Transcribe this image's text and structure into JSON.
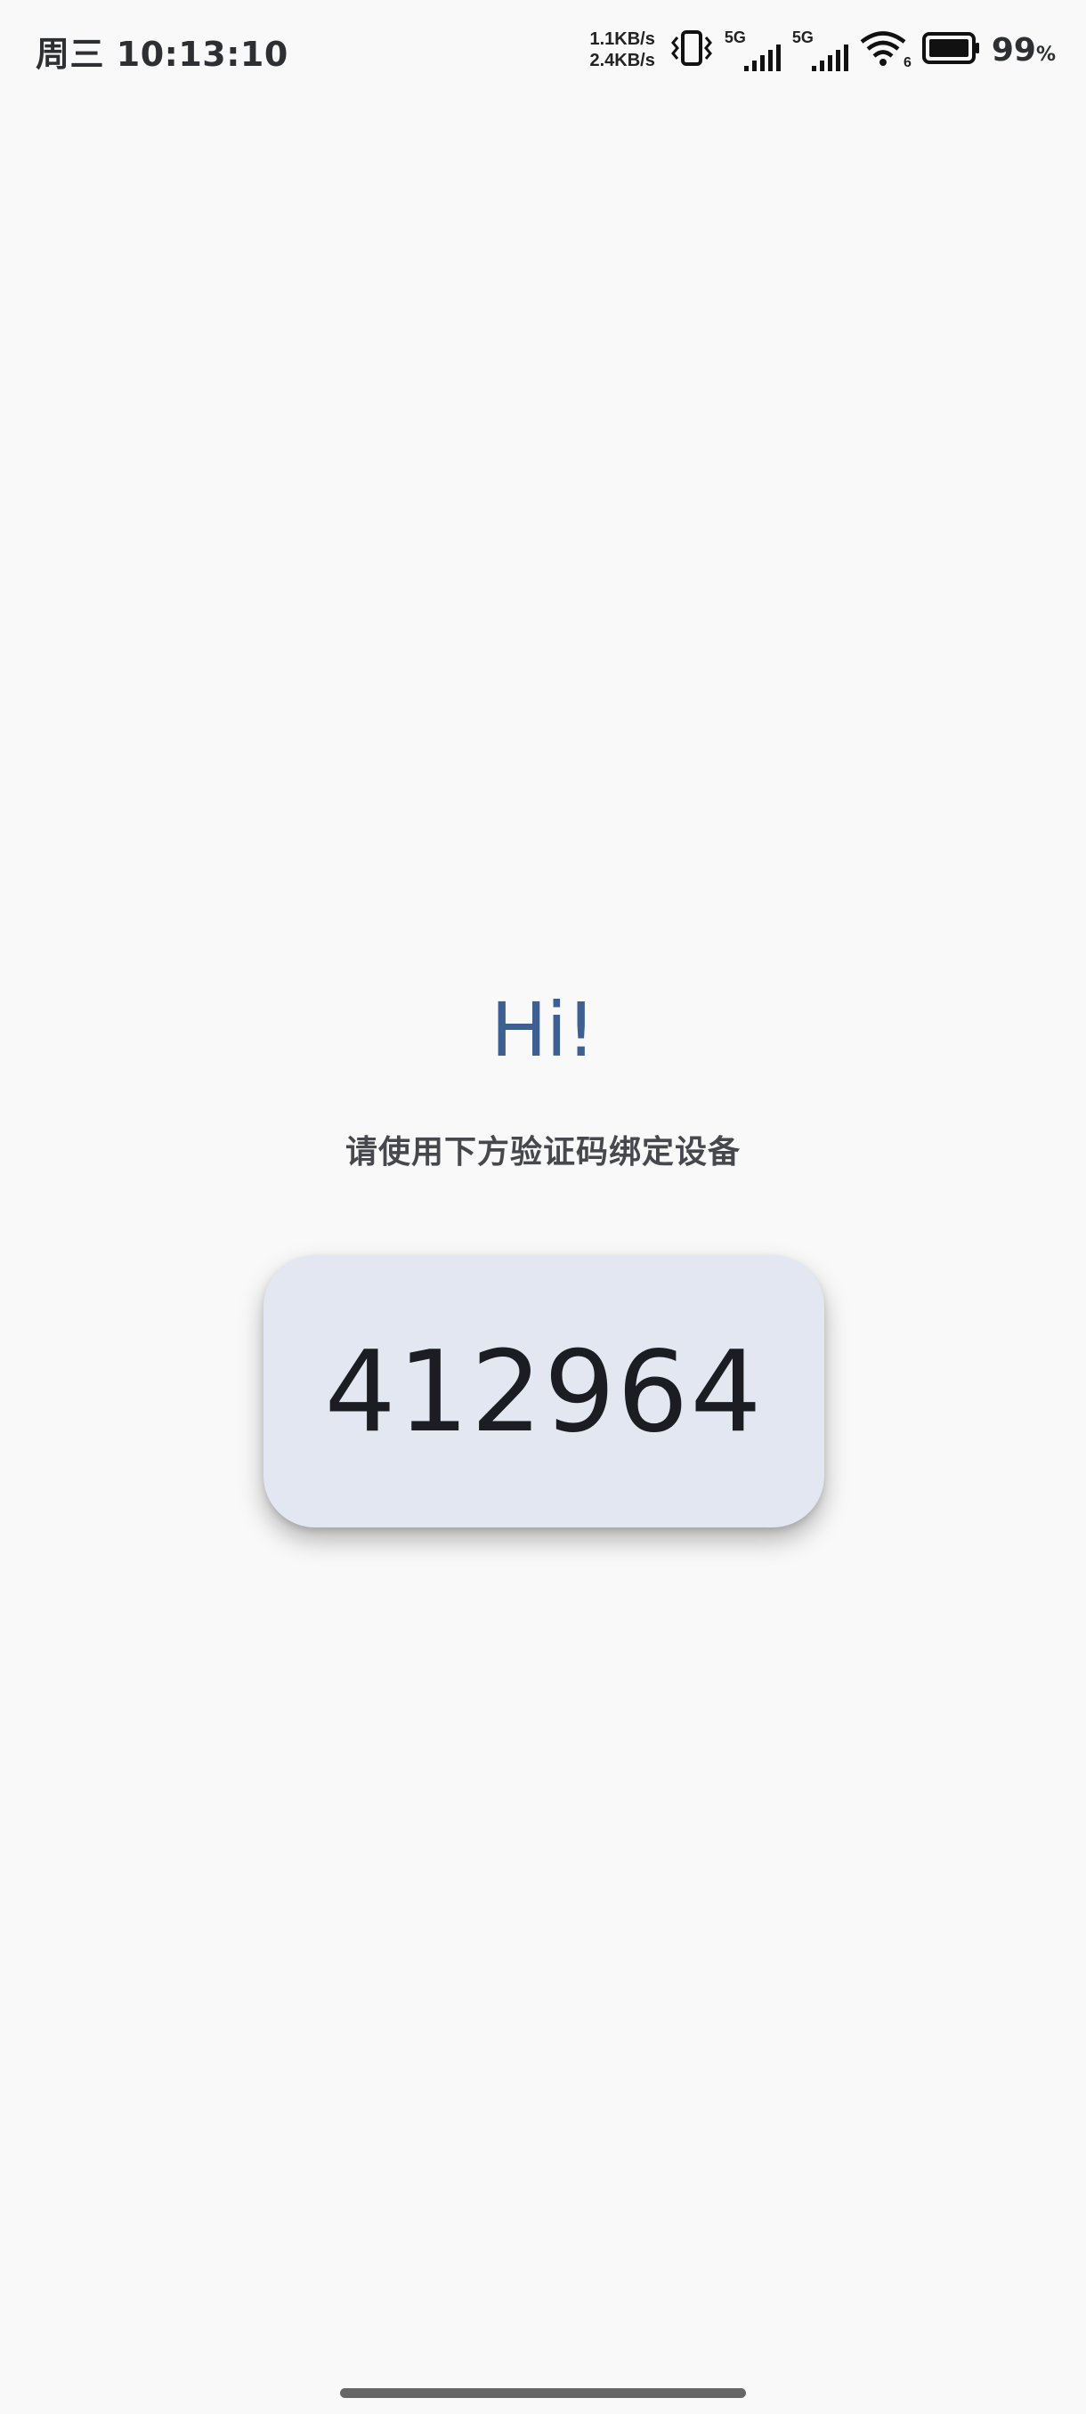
{
  "status_bar": {
    "day": "周三",
    "time": "10:13:10",
    "upload_speed": "1.1KB/s",
    "download_speed": "2.4KB/s",
    "sim1_label": "5G",
    "sim2_label": "5G",
    "wifi_label": "6",
    "battery_percent": "99",
    "battery_unit": "%",
    "icons": [
      "vibrate-icon",
      "signal-icon",
      "signal-icon",
      "wifi-icon",
      "battery-icon"
    ]
  },
  "main": {
    "greeting": "Hi!",
    "instruction": "请使用下方验证码绑定设备",
    "code": "412964"
  },
  "colors": {
    "background": "#f9f9f9",
    "greeting": "#3e5f92",
    "card": "#e3e7f1",
    "code_text": "#1b1d22",
    "instruction_text": "#47484d"
  }
}
